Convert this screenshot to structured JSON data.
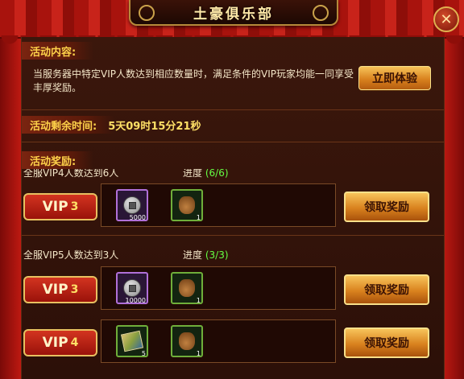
{
  "title": "土豪俱乐部",
  "close_icon": "close-icon",
  "content_label": "活动内容:",
  "description": "当服务器中特定VIP人数达到相应数量时，满足条件的VIP玩家均能一同享受丰厚奖励。",
  "try_button": "立即体验",
  "time_label": "活动剩余时间:",
  "time_value": "5天09时15分21秒",
  "reward_label": "活动奖励:",
  "groups": [
    {
      "condition": "全服VIP4人数达到6人",
      "progress_label": "进度",
      "progress": "(6/6)",
      "rows": [
        {
          "vip_text": "VIP",
          "vip_level": "3",
          "items": [
            {
              "icon": "silver-coin-icon",
              "count": "5000"
            },
            {
              "icon": "money-bag-icon",
              "count": "1"
            }
          ],
          "claim": "领取奖励"
        }
      ]
    },
    {
      "condition": "全服VIP5人数达到3人",
      "progress_label": "进度",
      "progress": "(3/3)",
      "rows": [
        {
          "vip_text": "VIP",
          "vip_level": "3",
          "items": [
            {
              "icon": "silver-coin-icon",
              "count": "10000"
            },
            {
              "icon": "money-bag-icon",
              "count": "1"
            }
          ],
          "claim": "领取奖励"
        },
        {
          "vip_text": "VIP",
          "vip_level": "4",
          "items": [
            {
              "icon": "treasure-map-icon",
              "count": "5"
            },
            {
              "icon": "money-bag-icon",
              "count": "1"
            }
          ],
          "claim": "领取奖励"
        }
      ]
    }
  ]
}
